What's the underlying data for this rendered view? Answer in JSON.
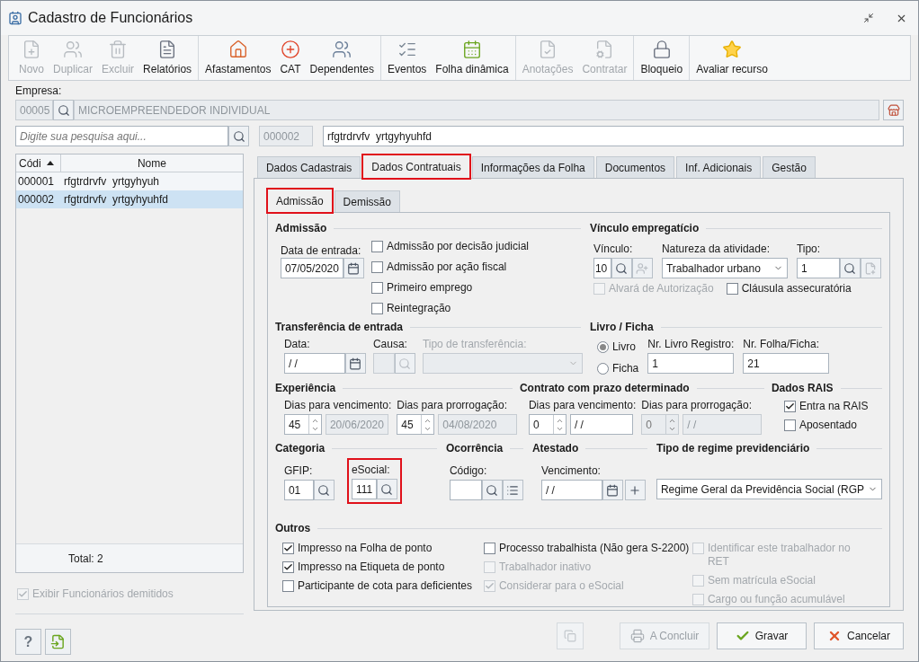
{
  "window": {
    "title": "Cadastro de Funcionários"
  },
  "toolbar": [
    {
      "items": [
        {
          "label": "Novo",
          "disabled": true
        },
        {
          "label": "Duplicar",
          "disabled": true
        },
        {
          "label": "Excluir",
          "disabled": true
        },
        {
          "label": "Relatórios",
          "disabled": false
        }
      ]
    },
    {
      "items": [
        {
          "label": "Afastamentos",
          "disabled": false
        },
        {
          "label": "CAT",
          "disabled": false
        },
        {
          "label": "Dependentes",
          "disabled": false
        }
      ]
    },
    {
      "items": [
        {
          "label": "Eventos",
          "disabled": false
        },
        {
          "label": "Folha dinâmica",
          "disabled": false
        }
      ]
    },
    {
      "items": [
        {
          "label": "Anotações",
          "disabled": true
        },
        {
          "label": "Contratar",
          "disabled": true
        }
      ]
    },
    {
      "items": [
        {
          "label": "Bloqueio",
          "disabled": false
        }
      ]
    },
    {
      "items": [
        {
          "label": "Avaliar recurso",
          "disabled": false
        }
      ]
    }
  ],
  "empresa": {
    "label": "Empresa:",
    "code": "00005",
    "name": "MICROEMPREENDEDOR INDIVIDUAL"
  },
  "search": {
    "placeholder": "Digite sua pesquisa aqui..."
  },
  "employee": {
    "code": "000002",
    "name": "rfgtrdrvfv  yrtgyhyuhfd"
  },
  "list": {
    "columns": [
      {
        "label": "Códi",
        "sorted": true
      },
      {
        "label": "Nome",
        "sorted": false
      }
    ],
    "rows": [
      {
        "code": "000001",
        "name": "rfgtrdrvfv  yrtgyhyuh",
        "selected": false
      },
      {
        "code": "000002",
        "name": "rfgtrdrvfv  yrtgyhyuhfd",
        "selected": true
      }
    ],
    "total": "Total: 2"
  },
  "show_dismissed": {
    "label": "Exibir Funcionários demitidos",
    "checked": true,
    "disabled": true
  },
  "tabs": [
    {
      "label": "Dados Cadastrais",
      "selected": false,
      "highlighted": false
    },
    {
      "label": "Dados Contratuais",
      "selected": true,
      "highlighted": true
    },
    {
      "label": "Informações da Folha",
      "selected": false,
      "highlighted": false
    },
    {
      "label": "Documentos",
      "selected": false,
      "highlighted": false
    },
    {
      "label": "Inf. Adicionais",
      "selected": false,
      "highlighted": false
    },
    {
      "label": "Gestão",
      "selected": false,
      "highlighted": false
    }
  ],
  "subtabs": [
    {
      "label": "Admissão",
      "selected": true,
      "highlighted": true
    },
    {
      "label": "Demissão",
      "selected": false,
      "highlighted": false
    }
  ],
  "admissao": {
    "title": "Admissão",
    "date_label": "Data de entrada:",
    "date": "07/05/2020",
    "checks": [
      {
        "label": "Admissão por decisão judicial",
        "checked": false
      },
      {
        "label": "Admissão por ação fiscal",
        "checked": false
      },
      {
        "label": "Primeiro emprego",
        "checked": false
      },
      {
        "label": "Reintegração",
        "checked": false
      }
    ]
  },
  "vinculo": {
    "title": "Vínculo empregatício",
    "vinculo_label": "Vínculo:",
    "vinculo": "10",
    "natureza_label": "Natureza da atividade:",
    "natureza": "Trabalhador urbano",
    "tipo_label": "Tipo:",
    "tipo": "1",
    "checks": [
      {
        "label": "Alvará de Autorização",
        "checked": false,
        "disabled": true
      },
      {
        "label": "Cláusula assecuratória",
        "checked": false,
        "disabled": false
      }
    ]
  },
  "transferencia": {
    "title": "Transferência de entrada",
    "data_label": "Data:",
    "data": " / /",
    "causa_label": "Causa:",
    "tipo_label": "Tipo de transferência:",
    "tipo_disabled": true
  },
  "livro": {
    "title": "Livro / Ficha",
    "options": [
      {
        "label": "Livro",
        "selected": true
      },
      {
        "label": "Ficha",
        "selected": false
      }
    ],
    "registro_label": "Nr. Livro Registro:",
    "registro": "1",
    "folha_label": "Nr. Folha/Ficha:",
    "folha": "21"
  },
  "experiencia": {
    "title": "Experiência",
    "venc_label": "Dias para vencimento:",
    "venc_days": {
      "value": "45",
      "disabled": false
    },
    "venc_date": {
      "value": "20/06/2020",
      "disabled": true
    },
    "prorr_label": "Dias para prorrogação:",
    "prorr_days": {
      "value": "45",
      "disabled": false
    },
    "prorr_date": {
      "value": "04/08/2020",
      "disabled": true
    }
  },
  "contrato": {
    "title": "Contrato com prazo determinado",
    "venc_label": "Dias para vencimento:",
    "venc_days": {
      "value": "0",
      "disabled": false
    },
    "venc_date": {
      "value": " / /",
      "disabled": false
    },
    "prorr_label": "Dias para prorrogação:",
    "prorr_days": {
      "value": "0",
      "disabled": true
    },
    "prorr_date": {
      "value": " / /",
      "disabled": true
    }
  },
  "rais": {
    "title": "Dados RAIS",
    "checks": [
      {
        "label": "Entra na RAIS",
        "checked": true
      },
      {
        "label": "Aposentado",
        "checked": false
      }
    ]
  },
  "categoria": {
    "title": "Categoria",
    "gfip_label": "GFIP:",
    "gfip": "01",
    "esocial_label": "eSocial:",
    "esocial": "111",
    "highlighted": true
  },
  "ocorrencia": {
    "title": "Ocorrência",
    "codigo_label": "Código:"
  },
  "atestado": {
    "title": "Atestado",
    "venc_label": "Vencimento:",
    "venc": " / /"
  },
  "regime": {
    "title": "Tipo de regime previdenciário",
    "value": "Regime Geral da Previdência Social (RGP"
  },
  "outros": {
    "title": "Outros",
    "columns": [
      {
        "items": [
          {
            "label": "Impresso na Folha de ponto",
            "checked": true,
            "disabled": false
          },
          {
            "label": "Impresso na Etiqueta de ponto",
            "checked": true,
            "disabled": false
          },
          {
            "label": "Participante de cota para deficientes",
            "checked": false,
            "disabled": false
          }
        ]
      },
      {
        "items": [
          {
            "label": "Processo trabalhista (Não gera S-2200)",
            "checked": false,
            "disabled": false
          },
          {
            "label": "Trabalhador inativo",
            "checked": false,
            "disabled": true
          },
          {
            "label": "Considerar para o eSocial",
            "checked": true,
            "disabled": true
          }
        ]
      },
      {
        "items": [
          {
            "label": "Identificar este trabalhador no RET",
            "checked": false,
            "disabled": true
          },
          {
            "label": "Sem matrícula eSocial",
            "checked": false,
            "disabled": true
          },
          {
            "label": "Cargo ou função acumulável",
            "checked": false,
            "disabled": true
          }
        ]
      }
    ]
  },
  "footer": {
    "help": "?",
    "copy_disabled": true,
    "actions": [
      {
        "label": "A Concluir",
        "disabled": true
      },
      {
        "label": "Gravar",
        "disabled": false
      },
      {
        "label": "Cancelar",
        "disabled": false
      }
    ]
  }
}
